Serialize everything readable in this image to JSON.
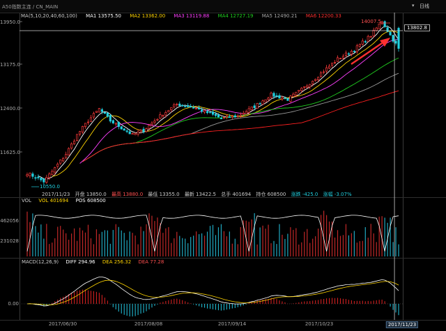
{
  "header": {
    "symbol": "A50指数主连 / CN_MAIN",
    "period": "日线"
  },
  "colors": {
    "up": "#ff3b3b",
    "down": "#20d0e0",
    "ma1": "#ffffff",
    "ma2": "#ffd400",
    "ma3": "#ff40ff",
    "ma4": "#20d020",
    "ma5": "#9a9a9a",
    "ma6": "#ff2020",
    "dif": "#ffffff",
    "dea": "#ffd400"
  },
  "main": {
    "ma_legend": {
      "title": "MA(5,10,20,40,60,100)",
      "ma1": "MA1 13575.50",
      "ma2": "MA2 13362.00",
      "ma3": "MA3 13119.88",
      "ma4": "MA4 12727.19",
      "ma5": "MA5 12490.21",
      "ma6": "MA6 12200.33"
    },
    "y_axis": [
      "13950.0",
      "13175.0",
      "12400.0",
      "11625.0"
    ],
    "high_label": "14007.5",
    "low_label": "10550.0",
    "crosshair_price": "13802.8",
    "info": {
      "date": "2017/11/23",
      "open": "开盘 13850.0",
      "high": "最高 13880.0",
      "low": "最低 13355.0",
      "close": "最新 13422.5",
      "volume": "总手 401694",
      "position": "持仓 608500",
      "change": "涨跌 -425.0",
      "pct": "涨幅 -3.07%"
    }
  },
  "volume": {
    "legend": {
      "title": "VOL",
      "vol": "VOL 401694",
      "pos": "POS 608500"
    },
    "y_axis": [
      "462056",
      "231028"
    ]
  },
  "macd": {
    "legend": {
      "title": "MACD(12,26,9)",
      "diff": "DIFF 294.96",
      "dea": "DEA 256.32",
      "macd": "DEA 77.28"
    },
    "y_axis": [
      "0.00"
    ]
  },
  "x_axis": {
    "labels": [
      "2017/06/30",
      "2017/08/08",
      "2017/09/14",
      "2017/10/23"
    ],
    "current": "2017/11/23"
  },
  "chart_data": {
    "type": "candlestick",
    "x_labels": [
      "2017/06/30",
      "2017/08/08",
      "2017/09/14",
      "2017/10/23",
      "2017/11/23"
    ],
    "ylim": [
      10450,
      14150
    ],
    "anchors_close": [
      [
        0,
        10800
      ],
      [
        6,
        10620
      ],
      [
        10,
        10900
      ],
      [
        14,
        11200
      ],
      [
        18,
        11600
      ],
      [
        22,
        11900
      ],
      [
        26,
        12150
      ],
      [
        30,
        11900
      ],
      [
        34,
        11750
      ],
      [
        38,
        11600
      ],
      [
        42,
        11700
      ],
      [
        48,
        12000
      ],
      [
        54,
        12250
      ],
      [
        60,
        12180
      ],
      [
        66,
        12050
      ],
      [
        70,
        11950
      ],
      [
        76,
        12000
      ],
      [
        82,
        12200
      ],
      [
        88,
        12450
      ],
      [
        94,
        12350
      ],
      [
        100,
        12600
      ],
      [
        106,
        12900
      ],
      [
        112,
        13200
      ],
      [
        118,
        13400
      ],
      [
        124,
        13700
      ],
      [
        128,
        14000
      ],
      [
        131,
        13700
      ],
      [
        134,
        13420
      ]
    ],
    "last_candle": {
      "open": 13850.0,
      "high": 13880.0,
      "low": 13355.0,
      "close": 13422.5,
      "volume": 401694,
      "position": 608500
    },
    "period_high": 14007.5,
    "period_low": 10550.0
  }
}
